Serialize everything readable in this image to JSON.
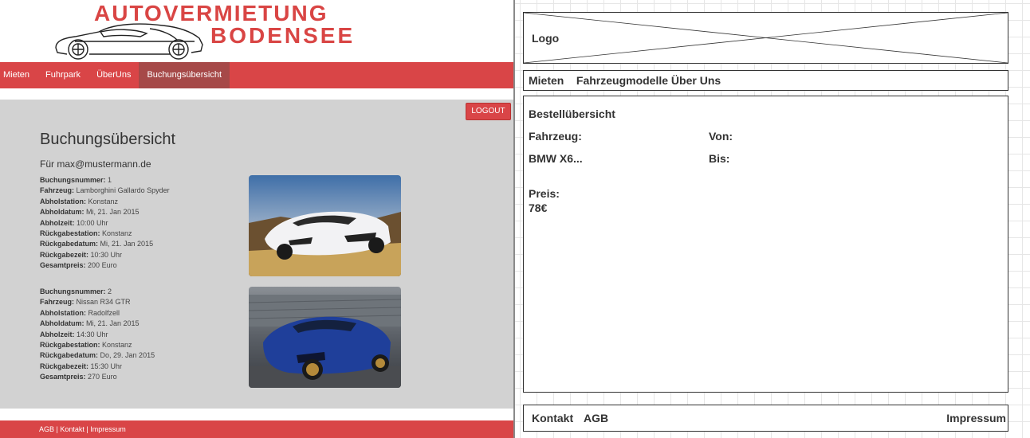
{
  "site": {
    "logo": {
      "line1": "AUTOVERMIETUNG",
      "line2": "BODENSEE"
    },
    "nav": [
      {
        "label": "Mieten"
      },
      {
        "label": "Fuhrpark"
      },
      {
        "label": "ÜberUns"
      },
      {
        "label": "Buchungsübersicht"
      }
    ],
    "logout_label": "LOGOUT",
    "page_title": "Buchungsübersicht",
    "user_line": "Für max@mustermann.de",
    "field_labels": {
      "booking_no": "Buchungsnummer:",
      "vehicle": "Fahrzeug:",
      "pickup_station": "Abholstation:",
      "pickup_date": "Abholdatum:",
      "pickup_time": "Abholzeit:",
      "return_station": "Rückgabestation:",
      "return_date": "Rückgabedatum:",
      "return_time": "Rückgabezeit:",
      "total_price": "Gesamtpreis:"
    },
    "bookings": [
      {
        "booking_no": "1",
        "vehicle": "Lamborghini Gallardo Spyder",
        "pickup_station": "Konstanz",
        "pickup_date": "Mi, 21. Jan 2015",
        "pickup_time": "10:00 Uhr",
        "return_station": "Konstanz",
        "return_date": "Mi, 21. Jan 2015",
        "return_time": "10:30 Uhr",
        "total_price": "200 Euro"
      },
      {
        "booking_no": "2",
        "vehicle": "Nissan R34 GTR",
        "pickup_station": "Radolfzell",
        "pickup_date": "Mi, 21. Jan 2015",
        "pickup_time": "14:30 Uhr",
        "return_station": "Konstanz",
        "return_date": "Do, 29. Jan 2015",
        "return_time": "15:30 Uhr",
        "total_price": "270 Euro"
      }
    ],
    "footer": {
      "agb": "AGB",
      "kontakt": "Kontakt",
      "impressum": "Impressum",
      "separator": " | "
    },
    "colors": {
      "brand_red": "#d94547",
      "active_nav": "#a64948",
      "content_bg": "#d2d2d2"
    }
  },
  "wireframe": {
    "logo_label": "Logo",
    "nav_text": "Mieten    Fahrzeugmodelle Über Uns",
    "section_title": "Bestellübersicht",
    "vehicle_label": "Fahrzeug:",
    "from_label": "Von:",
    "vehicle_value": "BMW X6...",
    "to_label": "Bis:",
    "price_label": "Preis:",
    "price_value": "78€",
    "footer_kontakt": "Kontakt",
    "footer_agb": "AGB",
    "footer_impressum": "Impressum"
  }
}
